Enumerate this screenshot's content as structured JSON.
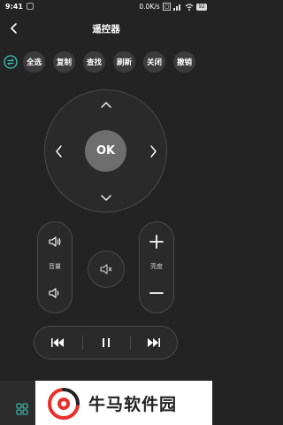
{
  "status_bar": {
    "time": "9:41",
    "network_speed": "0.0K/s",
    "battery": "92"
  },
  "header": {
    "title": "遥控器"
  },
  "toolbar": {
    "chips": [
      "全选",
      "复制",
      "查找",
      "刷新",
      "关闭",
      "撤销"
    ]
  },
  "dpad": {
    "ok_label": "OK"
  },
  "volume": {
    "label": "音量"
  },
  "brightness": {
    "label": "亮度"
  },
  "watermark": {
    "text": "牛马软件园"
  },
  "colors": {
    "background": "#232323",
    "button": "#3b3b3b",
    "ok": "#6e6e6e",
    "accent": "#3cc6b4"
  }
}
